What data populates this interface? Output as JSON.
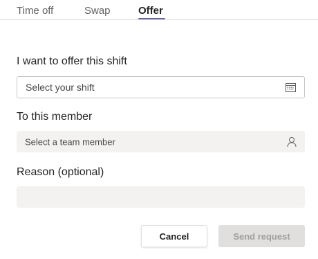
{
  "tabs": [
    {
      "label": "Time off"
    },
    {
      "label": "Swap"
    },
    {
      "label": "Offer"
    }
  ],
  "active_tab": "Offer",
  "colors": {
    "accent": "#6264a7",
    "field_fill": "#f3f2f1",
    "disabled_button": "#e1dfdd"
  },
  "form": {
    "shift_label": "I want to offer this shift",
    "shift_placeholder": "Select your shift",
    "shift_icon": "calendar-icon",
    "member_label": "To this member",
    "member_placeholder": "Select a team member",
    "member_icon": "person-icon",
    "reason_label": "Reason (optional)",
    "reason_value": ""
  },
  "buttons": {
    "cancel": "Cancel",
    "send": "Send request"
  }
}
